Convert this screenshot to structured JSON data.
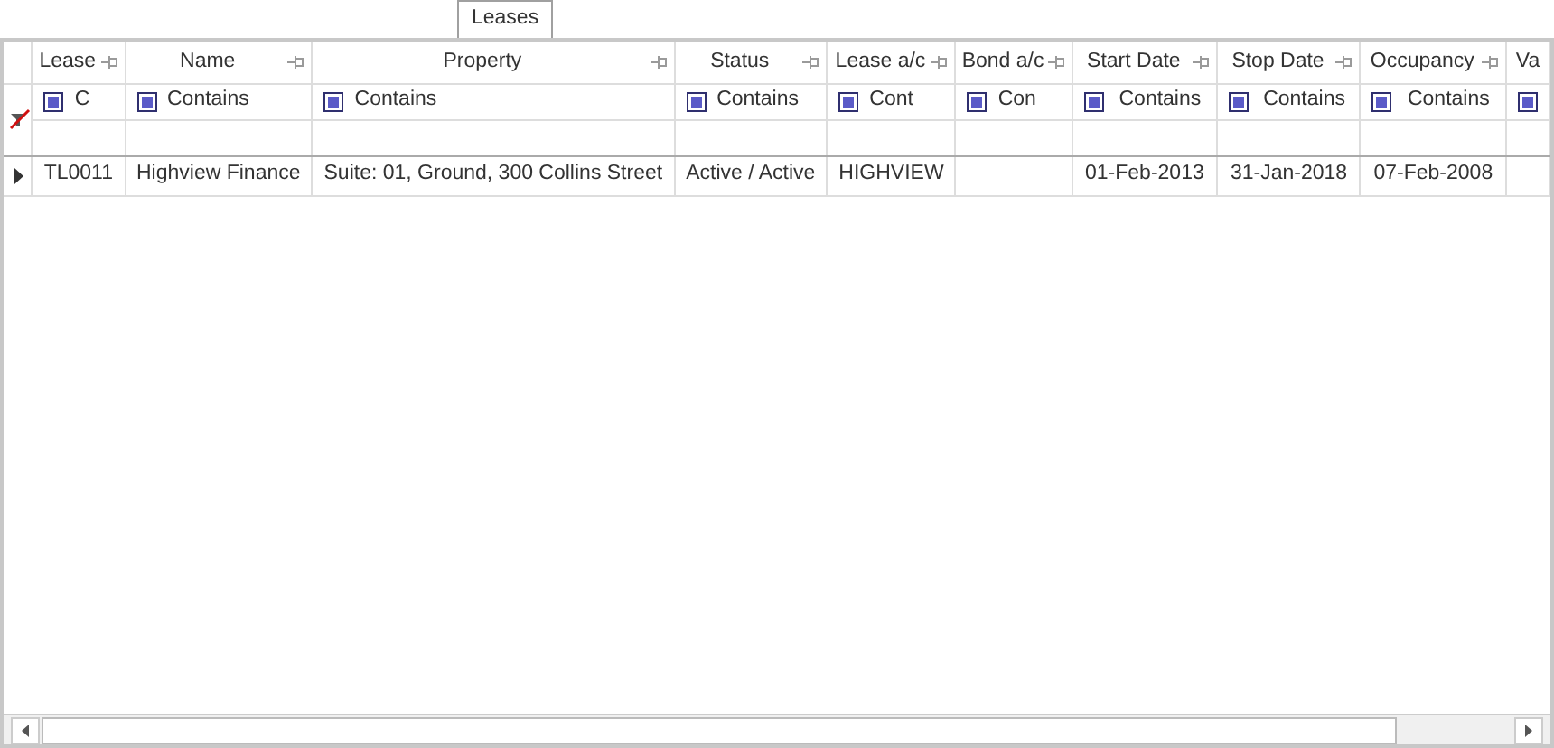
{
  "tabs": [
    {
      "label": "Leases",
      "selected": true
    }
  ],
  "grid": {
    "columns": [
      {
        "label": "Lease",
        "filter": "C"
      },
      {
        "label": "Name",
        "filter": "Contains"
      },
      {
        "label": "Property",
        "filter": "Contains"
      },
      {
        "label": "Status",
        "filter": "Contains"
      },
      {
        "label": "Lease a/c",
        "filter": "Cont"
      },
      {
        "label": "Bond a/c",
        "filter": "Con"
      },
      {
        "label": "Start Date",
        "filter": "Contains"
      },
      {
        "label": "Stop Date",
        "filter": "Contains"
      },
      {
        "label": "Occupancy",
        "filter": "Contains"
      },
      {
        "label": "Va"
      }
    ],
    "rows": [
      {
        "current": true,
        "cells": [
          "TL0011",
          "Highview Finance",
          "Suite: 01, Ground, 300 Collins Street",
          "Active / Active",
          "HIGHVIEW",
          "",
          "01-Feb-2013",
          "31-Jan-2018",
          "07-Feb-2008",
          ""
        ]
      }
    ]
  }
}
